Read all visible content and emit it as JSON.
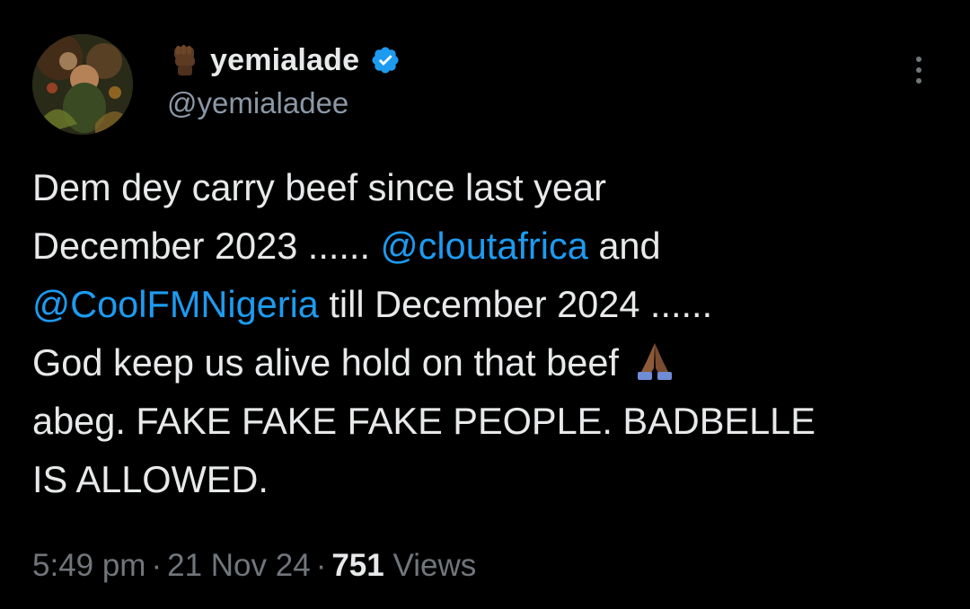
{
  "author": {
    "display_name": "yemialade",
    "handle": "@yemialadee",
    "badge_emoji_icon": "raised-fist-icon",
    "verified_icon": "verified-badge-icon",
    "verified_color": "#1d9bf0"
  },
  "tweet": {
    "lines": [
      [
        {
          "text": "Dem dey carry beef since last year"
        }
      ],
      [
        {
          "text": "December 2023 ...... "
        },
        {
          "text": "@cloutafrica",
          "mention": true
        },
        {
          "text": " and"
        }
      ],
      [
        {
          "text": "@CoolFMNigeria",
          "mention": true
        },
        {
          "text": " till December 2024 ......"
        }
      ],
      [
        {
          "text": "God keep us alive hold on that beef"
        }
      ],
      [
        {
          "text": "abeg. FAKE FAKE FAKE PEOPLE. BADBELLE"
        }
      ],
      [
        {
          "text": "IS ALLOWED."
        }
      ]
    ],
    "emoji_after_line_4": "folded-hands-icon"
  },
  "meta": {
    "time": "5:49 pm",
    "separator": "·",
    "date": "21 Nov 24",
    "views_count": "751",
    "views_label": "Views"
  },
  "menu": {
    "icon": "more-options-icon"
  },
  "colors": {
    "background": "#000000",
    "text": "#e7e9ea",
    "secondary": "#71767b",
    "mention": "#1d9bf0"
  }
}
